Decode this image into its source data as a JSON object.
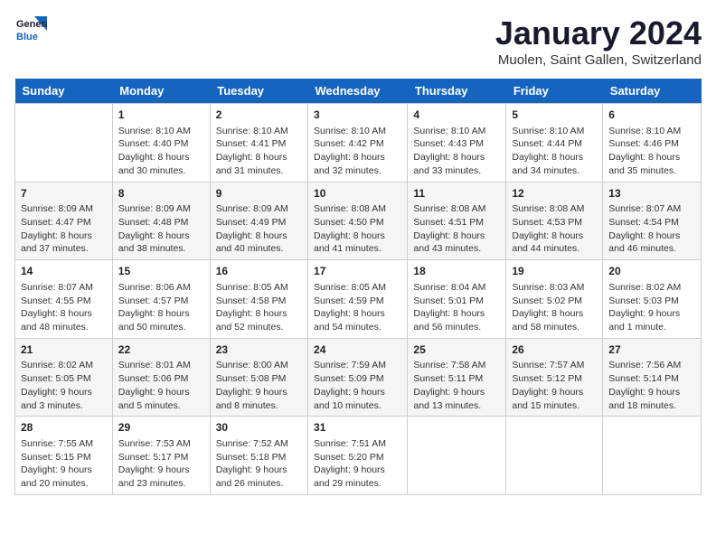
{
  "header": {
    "logo_line1": "General",
    "logo_line2": "Blue",
    "month": "January 2024",
    "location": "Muolen, Saint Gallen, Switzerland"
  },
  "days_of_week": [
    "Sunday",
    "Monday",
    "Tuesday",
    "Wednesday",
    "Thursday",
    "Friday",
    "Saturday"
  ],
  "weeks": [
    [
      {
        "day": "",
        "sunrise": "",
        "sunset": "",
        "daylight": ""
      },
      {
        "day": "1",
        "sunrise": "8:10 AM",
        "sunset": "4:40 PM",
        "daylight": "8 hours and 30 minutes."
      },
      {
        "day": "2",
        "sunrise": "8:10 AM",
        "sunset": "4:41 PM",
        "daylight": "8 hours and 31 minutes."
      },
      {
        "day": "3",
        "sunrise": "8:10 AM",
        "sunset": "4:42 PM",
        "daylight": "8 hours and 32 minutes."
      },
      {
        "day": "4",
        "sunrise": "8:10 AM",
        "sunset": "4:43 PM",
        "daylight": "8 hours and 33 minutes."
      },
      {
        "day": "5",
        "sunrise": "8:10 AM",
        "sunset": "4:44 PM",
        "daylight": "8 hours and 34 minutes."
      },
      {
        "day": "6",
        "sunrise": "8:10 AM",
        "sunset": "4:46 PM",
        "daylight": "8 hours and 35 minutes."
      }
    ],
    [
      {
        "day": "7",
        "sunrise": "8:09 AM",
        "sunset": "4:47 PM",
        "daylight": "8 hours and 37 minutes."
      },
      {
        "day": "8",
        "sunrise": "8:09 AM",
        "sunset": "4:48 PM",
        "daylight": "8 hours and 38 minutes."
      },
      {
        "day": "9",
        "sunrise": "8:09 AM",
        "sunset": "4:49 PM",
        "daylight": "8 hours and 40 minutes."
      },
      {
        "day": "10",
        "sunrise": "8:08 AM",
        "sunset": "4:50 PM",
        "daylight": "8 hours and 41 minutes."
      },
      {
        "day": "11",
        "sunrise": "8:08 AM",
        "sunset": "4:51 PM",
        "daylight": "8 hours and 43 minutes."
      },
      {
        "day": "12",
        "sunrise": "8:08 AM",
        "sunset": "4:53 PM",
        "daylight": "8 hours and 44 minutes."
      },
      {
        "day": "13",
        "sunrise": "8:07 AM",
        "sunset": "4:54 PM",
        "daylight": "8 hours and 46 minutes."
      }
    ],
    [
      {
        "day": "14",
        "sunrise": "8:07 AM",
        "sunset": "4:55 PM",
        "daylight": "8 hours and 48 minutes."
      },
      {
        "day": "15",
        "sunrise": "8:06 AM",
        "sunset": "4:57 PM",
        "daylight": "8 hours and 50 minutes."
      },
      {
        "day": "16",
        "sunrise": "8:05 AM",
        "sunset": "4:58 PM",
        "daylight": "8 hours and 52 minutes."
      },
      {
        "day": "17",
        "sunrise": "8:05 AM",
        "sunset": "4:59 PM",
        "daylight": "8 hours and 54 minutes."
      },
      {
        "day": "18",
        "sunrise": "8:04 AM",
        "sunset": "5:01 PM",
        "daylight": "8 hours and 56 minutes."
      },
      {
        "day": "19",
        "sunrise": "8:03 AM",
        "sunset": "5:02 PM",
        "daylight": "8 hours and 58 minutes."
      },
      {
        "day": "20",
        "sunrise": "8:02 AM",
        "sunset": "5:03 PM",
        "daylight": "9 hours and 1 minute."
      }
    ],
    [
      {
        "day": "21",
        "sunrise": "8:02 AM",
        "sunset": "5:05 PM",
        "daylight": "9 hours and 3 minutes."
      },
      {
        "day": "22",
        "sunrise": "8:01 AM",
        "sunset": "5:06 PM",
        "daylight": "9 hours and 5 minutes."
      },
      {
        "day": "23",
        "sunrise": "8:00 AM",
        "sunset": "5:08 PM",
        "daylight": "9 hours and 8 minutes."
      },
      {
        "day": "24",
        "sunrise": "7:59 AM",
        "sunset": "5:09 PM",
        "daylight": "9 hours and 10 minutes."
      },
      {
        "day": "25",
        "sunrise": "7:58 AM",
        "sunset": "5:11 PM",
        "daylight": "9 hours and 13 minutes."
      },
      {
        "day": "26",
        "sunrise": "7:57 AM",
        "sunset": "5:12 PM",
        "daylight": "9 hours and 15 minutes."
      },
      {
        "day": "27",
        "sunrise": "7:56 AM",
        "sunset": "5:14 PM",
        "daylight": "9 hours and 18 minutes."
      }
    ],
    [
      {
        "day": "28",
        "sunrise": "7:55 AM",
        "sunset": "5:15 PM",
        "daylight": "9 hours and 20 minutes."
      },
      {
        "day": "29",
        "sunrise": "7:53 AM",
        "sunset": "5:17 PM",
        "daylight": "9 hours and 23 minutes."
      },
      {
        "day": "30",
        "sunrise": "7:52 AM",
        "sunset": "5:18 PM",
        "daylight": "9 hours and 26 minutes."
      },
      {
        "day": "31",
        "sunrise": "7:51 AM",
        "sunset": "5:20 PM",
        "daylight": "9 hours and 29 minutes."
      },
      {
        "day": "",
        "sunrise": "",
        "sunset": "",
        "daylight": ""
      },
      {
        "day": "",
        "sunrise": "",
        "sunset": "",
        "daylight": ""
      },
      {
        "day": "",
        "sunrise": "",
        "sunset": "",
        "daylight": ""
      }
    ]
  ]
}
